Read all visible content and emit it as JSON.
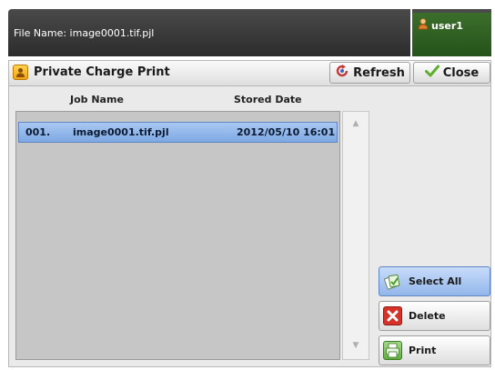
{
  "header": {
    "file_name": "File Name: image0001.tif.pjl",
    "user": "user1"
  },
  "window": {
    "title": "Private Charge Print",
    "refresh_label": "Refresh",
    "close_label": "Close"
  },
  "columns": {
    "job_name": "Job Name",
    "stored_date": "Stored Date"
  },
  "jobs": [
    {
      "number": "001.",
      "name": "image0001.tif.pjl",
      "date": "2012/05/10 16:01",
      "selected": true
    }
  ],
  "scroll": {
    "up": "▲",
    "down": "▼"
  },
  "actions": {
    "select_all": "Select All",
    "delete": "Delete",
    "print": "Print"
  },
  "colors": {
    "header_dark": "#2c2c2c",
    "user_green": "#25531a",
    "selection_blue": "#7ea9e3"
  }
}
